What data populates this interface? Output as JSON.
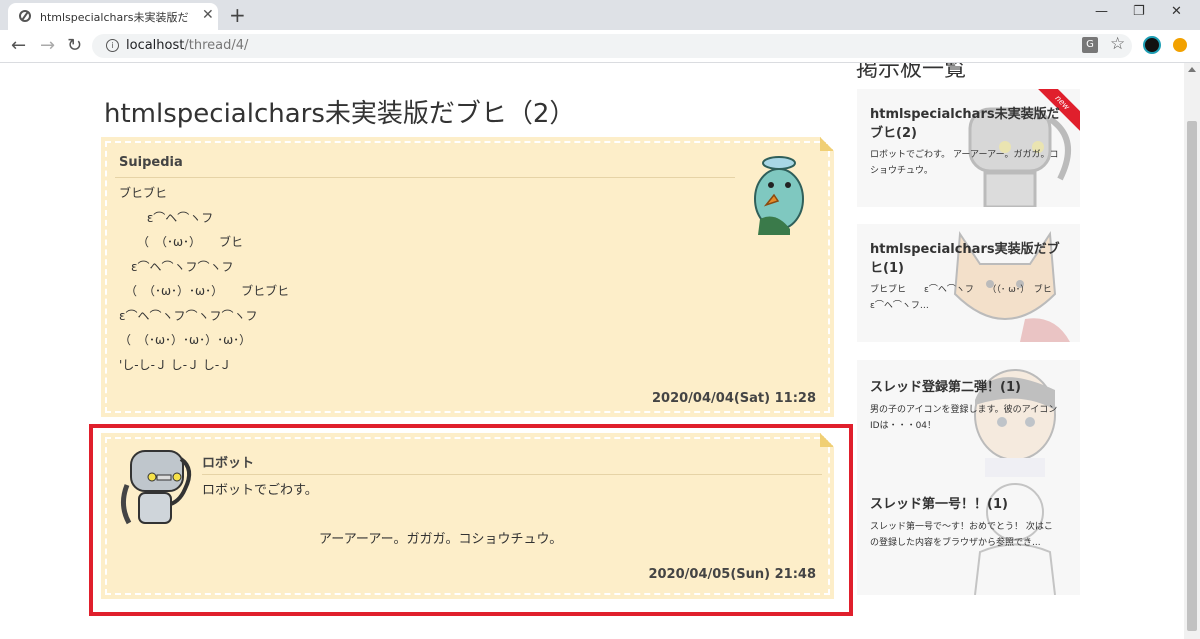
{
  "browser": {
    "tab_title": "htmlspecialchars未実装版だブヒ（",
    "tab_close": "✕",
    "new_tab": "+",
    "minimize": "—",
    "restore": "❐",
    "close": "✕",
    "back": "←",
    "forward": "→",
    "reload": "↻",
    "url_host": "localhost",
    "url_path": "/thread/4/",
    "translate_icon": "G",
    "star": "☆"
  },
  "sidebar": {
    "heading": "掲示板一覧",
    "cards": [
      {
        "title": "htmlspecialchars未実装版だブヒ(2)",
        "text": "ロボットでごわす。 アーアーアー。ガガガ。コショウチュウ。",
        "badge": "new"
      },
      {
        "title": "htmlspecialchars実装版だブヒ(1)",
        "text": "ブヒブヒ　　ε⌒ヘ⌒ヽフ　　（（･ ω･）　ブヒ　ε⌒ヘ⌒ヽフ…"
      },
      {
        "title": "スレッド登録第二弾！(1)",
        "text": "男の子のアイコンを登録します。彼のアイコンIDは・・・04！"
      },
      {
        "title": "スレッド第一号！！(1)",
        "text": "スレッド第一号で～す！おめでとう！ 次はこの登録した内容をブラウザから参照でき..."
      }
    ]
  },
  "thread": {
    "title": "htmlspecialchars未実装版だブヒ（2）",
    "posts": [
      {
        "name": "Suipedia",
        "body": "ブヒブヒ\n　　 ε⌒ヘ⌒ヽフ\n　　（　（･ω･）　　ブヒ\n　ε⌒ヘ⌒ヽフ⌒ヽフ\n　（　（･ω･）･ω･）　　ブヒブヒ\nε⌒ヘ⌒ヽフ⌒ヽフ⌒ヽフ\n（　（･ω･）･ω･）･ω･）\n'し-し-Ｊ し-Ｊ し-Ｊ",
        "date": "2020/04/04(Sat) 11:28"
      },
      {
        "name": "ロボット",
        "body": "ロボットでごわす。\n\n　　　　　　　　　アーアーアー。ガガガ。コショウチュウ。",
        "date": "2020/04/05(Sun) 21:48"
      }
    ]
  }
}
